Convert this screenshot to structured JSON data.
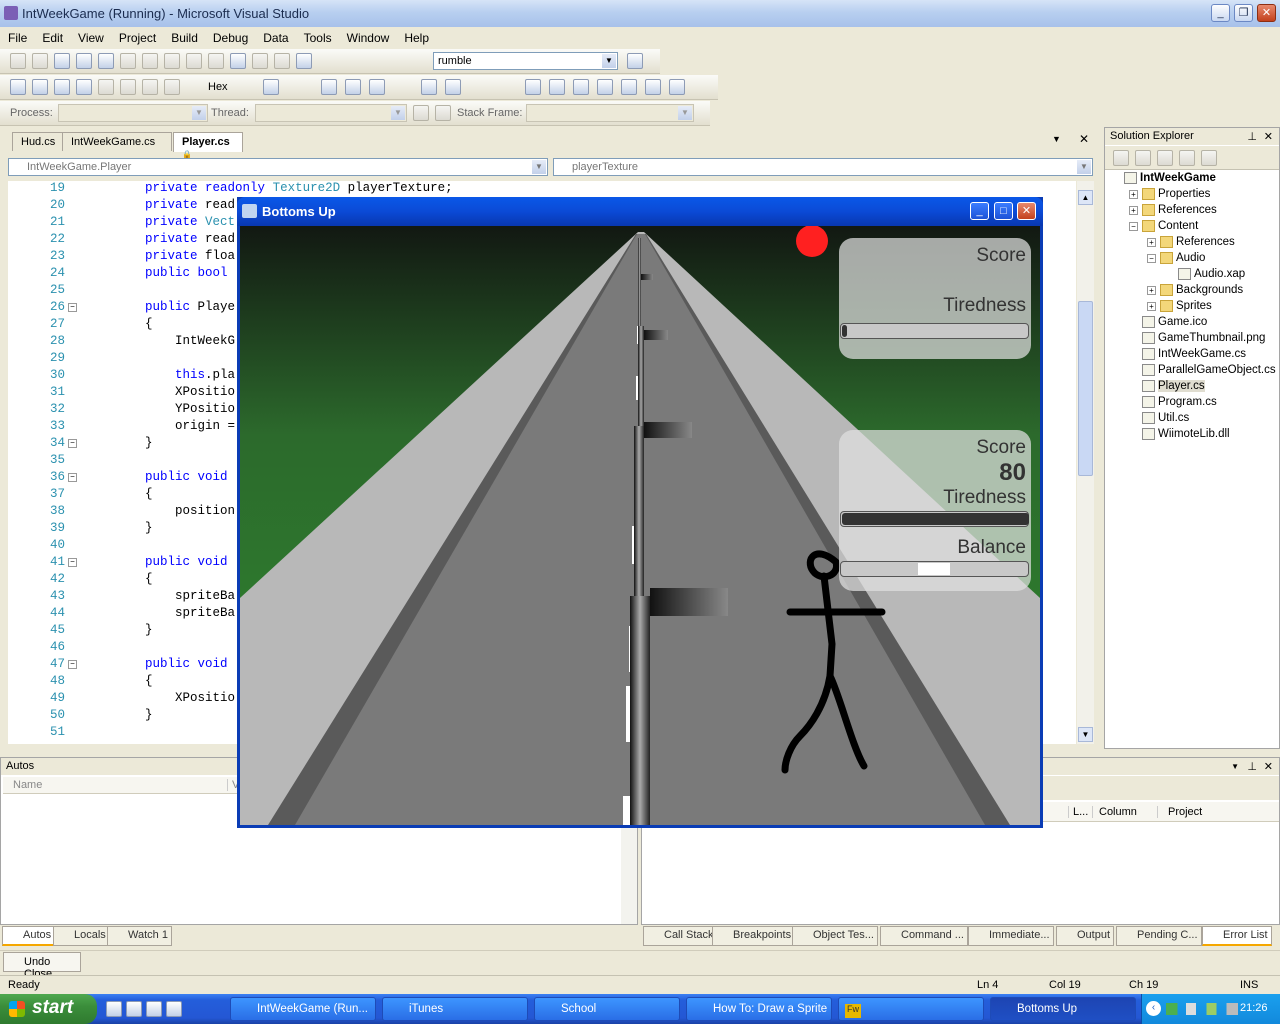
{
  "window": {
    "title": "IntWeekGame (Running) - Microsoft Visual Studio"
  },
  "menu": [
    "File",
    "Edit",
    "View",
    "Project",
    "Build",
    "Debug",
    "Data",
    "Tools",
    "Window",
    "Help"
  ],
  "toolbar": {
    "search_value": "rumble",
    "hex_label": "Hex",
    "process_label": "Process:",
    "thread_label": "Thread:",
    "stack_frame_label": "Stack Frame:"
  },
  "tabs": [
    "Hud.cs",
    "IntWeekGame.cs",
    "Player.cs"
  ],
  "nav": {
    "type": "IntWeekGame.Player",
    "member": "playerTexture"
  },
  "code_lines": [
    {
      "n": "19",
      "t": "private readonly Texture2D playerTexture;"
    },
    {
      "n": "20",
      "t": "private read"
    },
    {
      "n": "21",
      "t": "private Vect"
    },
    {
      "n": "22",
      "t": "private read"
    },
    {
      "n": "23",
      "t": "private floa"
    },
    {
      "n": "24",
      "t": "public bool "
    },
    {
      "n": "25",
      "t": ""
    },
    {
      "n": "26",
      "t": "public Playe"
    },
    {
      "n": "27",
      "t": "{"
    },
    {
      "n": "28",
      "t": "    IntWeekG"
    },
    {
      "n": "29",
      "t": ""
    },
    {
      "n": "30",
      "t": "    this.pla"
    },
    {
      "n": "31",
      "t": "    XPositio"
    },
    {
      "n": "32",
      "t": "    YPositio"
    },
    {
      "n": "33",
      "t": "    origin ="
    },
    {
      "n": "34",
      "t": "}"
    },
    {
      "n": "35",
      "t": ""
    },
    {
      "n": "36",
      "t": "public void "
    },
    {
      "n": "37",
      "t": "{"
    },
    {
      "n": "38",
      "t": "    position"
    },
    {
      "n": "39",
      "t": "}"
    },
    {
      "n": "40",
      "t": ""
    },
    {
      "n": "41",
      "t": "public void "
    },
    {
      "n": "42",
      "t": "{"
    },
    {
      "n": "43",
      "t": "    spriteBa"
    },
    {
      "n": "44",
      "t": "    spriteBa"
    },
    {
      "n": "45",
      "t": "}"
    },
    {
      "n": "46",
      "t": ""
    },
    {
      "n": "47",
      "t": "public void "
    },
    {
      "n": "48",
      "t": "{"
    },
    {
      "n": "49",
      "t": "    XPositio"
    },
    {
      "n": "50",
      "t": "}"
    },
    {
      "n": "51",
      "t": ""
    }
  ],
  "solution_explorer": {
    "title": "Solution Explorer",
    "items": [
      {
        "label": "IntWeekGame",
        "level": 0,
        "bold": true
      },
      {
        "label": "Properties",
        "level": 1
      },
      {
        "label": "References",
        "level": 1
      },
      {
        "label": "Content",
        "level": 1
      },
      {
        "label": "References",
        "level": 2
      },
      {
        "label": "Audio",
        "level": 2
      },
      {
        "label": "Audio.xap",
        "level": 3
      },
      {
        "label": "Backgrounds",
        "level": 2
      },
      {
        "label": "Sprites",
        "level": 2
      },
      {
        "label": "Game.ico",
        "level": 1
      },
      {
        "label": "GameThumbnail.png",
        "level": 1
      },
      {
        "label": "IntWeekGame.cs",
        "level": 1
      },
      {
        "label": "ParallelGameObject.cs",
        "level": 1
      },
      {
        "label": "Player.cs",
        "level": 1,
        "selected": true
      },
      {
        "label": "Program.cs",
        "level": 1
      },
      {
        "label": "Util.cs",
        "level": 1
      },
      {
        "label": "WiimoteLib.dll",
        "level": 1
      }
    ]
  },
  "autos": {
    "title": "Autos",
    "col_name": "Name",
    "col_value": "Va"
  },
  "errors": {
    "cols": [
      "L...",
      "Column",
      "Project"
    ]
  },
  "bottom_tabs_left": [
    "Autos",
    "Locals",
    "Watch 1"
  ],
  "bottom_tabs_right": [
    "Call Stack",
    "Breakpoints",
    "Object Tes...",
    "Command ...",
    "Immediate...",
    "Output",
    "Pending C...",
    "Error List"
  ],
  "undo_close": "Undo Close",
  "status": {
    "ready": "Ready",
    "ln": "Ln 4",
    "col": "Col 19",
    "ch": "Ch 19",
    "ins": "INS"
  },
  "taskbar": {
    "start": "start",
    "tasks": [
      "IntWeekGame (Run...",
      "iTunes",
      "School",
      "How To: Draw a Sprite",
      "",
      "Bottoms Up"
    ],
    "clock": "21:26"
  },
  "game": {
    "title": "Bottoms Up",
    "hud1": {
      "score_label": "Score",
      "tiredness_label": "Tiredness",
      "tiredness": 0.02
    },
    "hud2": {
      "score_label": "Score",
      "score": "80",
      "tiredness_label": "Tiredness",
      "tiredness": 1.0,
      "balance_label": "Balance",
      "balance": 0.49
    },
    "colors": {
      "grass": "#2f8a2f",
      "road": "#7a7a7a",
      "ball": "#ff2020"
    }
  }
}
